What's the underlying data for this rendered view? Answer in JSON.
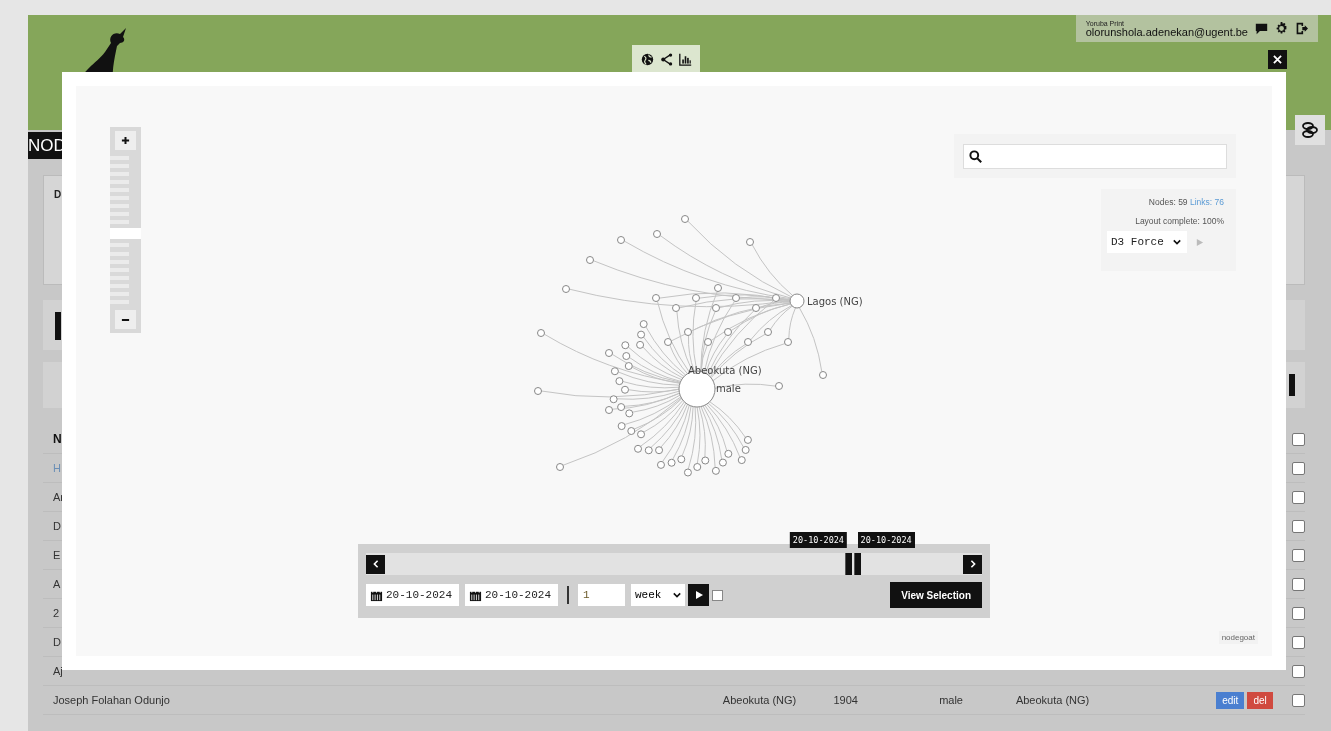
{
  "header": {
    "app": "Yoruba Print",
    "email": "olorunshola.adenekan@ugent.be"
  },
  "page": {
    "title_fragment": "NOD",
    "panel_fragment": "D"
  },
  "table": {
    "header_fragment": "N",
    "header_checked": false,
    "rows": [
      {
        "name": "H",
        "checked": false
      },
      {
        "name": "Ar",
        "checked": false
      },
      {
        "name": "D",
        "checked": false
      },
      {
        "name": "E",
        "checked": false
      },
      {
        "name": "A",
        "checked": false
      },
      {
        "name": "2",
        "checked": false
      },
      {
        "name": "D",
        "checked": false
      },
      {
        "name": "Aj",
        "checked": false
      },
      {
        "name": "Joseph Folahan Odunjo",
        "birthplace": "Abeokuta (NG)",
        "year": "1904",
        "gender": "male",
        "place": "Abeokuta (NG)",
        "actions": [
          {
            "label": "edit",
            "kind": "edit"
          },
          {
            "label": "del",
            "kind": "delete"
          }
        ],
        "checked": false
      }
    ]
  },
  "modal": {
    "zoom": {
      "level": 0.5
    },
    "graph": {
      "labels": [
        "Abeokuta (NG)",
        "male",
        "Lagos (NG)"
      ]
    },
    "stats": {
      "nodes": "Nodes: 59",
      "links": "Links: 76",
      "layout": "Layout complete: 100%"
    },
    "layout_select": "D3 Force",
    "run_disabled": true,
    "timeline": {
      "handles": [
        {
          "label": "20-10-2024",
          "level": 0.8
        },
        {
          "label": "20-10-2024",
          "level": 0.815
        }
      ],
      "start_date": "20-10-2024",
      "end_date": "20-10-2024",
      "step": "1",
      "unit": "week",
      "checked": false,
      "button": "View Selection"
    },
    "footer": "nodegoat"
  }
}
